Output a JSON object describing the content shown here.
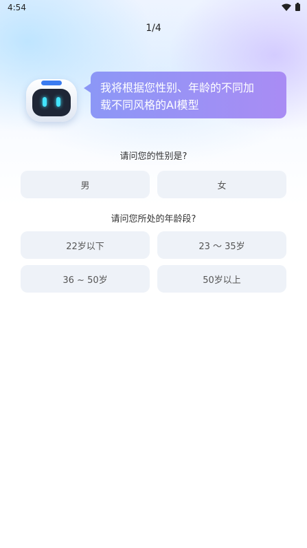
{
  "status_bar": {
    "time": "4:54",
    "icons": [
      "wifi-icon",
      "battery-icon"
    ]
  },
  "progress": {
    "label": "1/4",
    "current": 1,
    "total": 4
  },
  "assistant": {
    "avatar_icon": "robot-icon",
    "message_line1": "我将根据您性别、年龄的不同加",
    "message_line2": "载不同风格的AI模型"
  },
  "gender_question": {
    "label": "请问您的性别是?",
    "options": [
      "男",
      "女"
    ]
  },
  "age_question": {
    "label": "请问您所处的年龄段?",
    "options": [
      "22岁以下",
      "23 ～ 35岁",
      "36 ~ 50岁",
      "50岁以上"
    ]
  },
  "colors": {
    "bubble_start": "#8c97f6",
    "bubble_end": "#a98cf4",
    "option_background": "#eef2f8",
    "robot_eye": "#43e4ff",
    "robot_antenna": "#3b7cf0"
  }
}
